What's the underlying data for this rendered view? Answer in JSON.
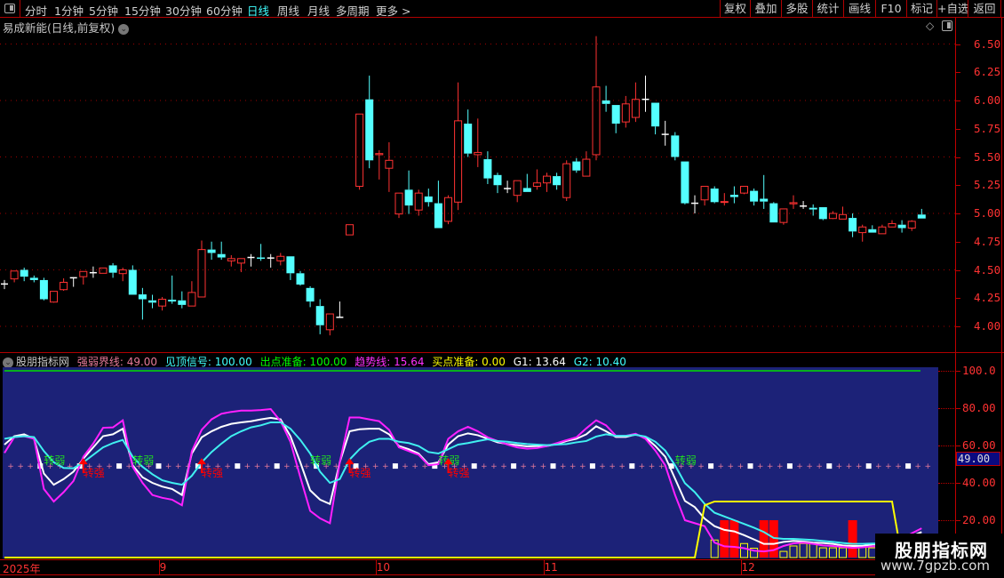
{
  "toolbar": {
    "periods": [
      "分时",
      "1分钟",
      "5分钟",
      "15分钟",
      "30分钟",
      "60分钟",
      "日线",
      "周线",
      "月线",
      "多周期",
      "更多 >"
    ],
    "active_period": "日线",
    "buttons": [
      "复权",
      "叠加",
      "多股",
      "统计",
      "画线",
      "F10",
      "标记",
      "+自选",
      "返回"
    ]
  },
  "chart_title": "易成新能(日线,前复权)",
  "indicator_header": {
    "name": "股朋指标网",
    "items": [
      {
        "label": "强弱界线: 49.00",
        "color": "#e67a9a"
      },
      {
        "label": "见顶信号: 100.00",
        "color": "#40ffff"
      },
      {
        "label": "出点准备: 100.00",
        "color": "#00ff00"
      },
      {
        "label": "趋势线: 15.64",
        "color": "#ff30ff"
      },
      {
        "label": "买点准备: 0.00",
        "color": "#ffff00"
      },
      {
        "label": "G1: 13.64",
        "color": "#ffffff"
      },
      {
        "label": "G2: 10.40",
        "color": "#40ffff"
      }
    ]
  },
  "indicator_value_box": "49.00",
  "watermark": {
    "title": "股朋指标网",
    "url": "www.7gpzb.com"
  },
  "colors": {
    "up": "#ff3232",
    "down": "#54ffff",
    "panel_bg": "#1c2278",
    "axis": "#ff3232"
  },
  "chart_data": [
    {
      "type": "candlestick",
      "title": "易成新能(日线,前复权)",
      "ylim": [
        3.9,
        6.6
      ],
      "y_ticks": [
        "6.50",
        "6.25",
        "6.00",
        "5.75",
        "5.50",
        "5.25",
        "5.00",
        "4.75",
        "4.50",
        "4.25",
        "4.00"
      ],
      "grid_values": [
        6.5,
        6.0,
        5.5,
        5.0,
        4.5,
        4.0
      ],
      "x_labels": [
        {
          "label": "2025年",
          "index": 0
        },
        {
          "label": "9",
          "index": 16
        },
        {
          "label": "10",
          "index": 38
        },
        {
          "label": "11",
          "index": 55
        },
        {
          "label": "12",
          "index": 75
        }
      ],
      "ohlc": [
        [
          4.375,
          4.41,
          4.33,
          4.375
        ],
        [
          4.42,
          4.49,
          4.39,
          4.49
        ],
        [
          4.5,
          4.52,
          4.4,
          4.44
        ],
        [
          4.43,
          4.45,
          4.39,
          4.41
        ],
        [
          4.41,
          4.43,
          4.23,
          4.24
        ],
        [
          4.215,
          4.31,
          4.21,
          4.31
        ],
        [
          4.325,
          4.425,
          4.315,
          4.39
        ],
        [
          4.43,
          4.435,
          4.35,
          4.43
        ],
        [
          4.44,
          4.486,
          4.37,
          4.486
        ],
        [
          4.475,
          4.53,
          4.43,
          4.475
        ],
        [
          4.47,
          4.517,
          4.47,
          4.517
        ],
        [
          4.54,
          4.56,
          4.43,
          4.475
        ],
        [
          4.467,
          4.52,
          4.4,
          4.5
        ],
        [
          4.5,
          4.54,
          4.28,
          4.28
        ],
        [
          4.283,
          4.34,
          4.06,
          4.24
        ],
        [
          4.23,
          4.28,
          4.16,
          4.21
        ],
        [
          4.18,
          4.26,
          4.14,
          4.24
        ],
        [
          4.236,
          4.45,
          4.2,
          4.22
        ],
        [
          4.23,
          4.31,
          4.16,
          4.19
        ],
        [
          4.18,
          4.4,
          4.18,
          4.3
        ],
        [
          4.26,
          4.76,
          4.26,
          4.68
        ],
        [
          4.68,
          4.75,
          4.59,
          4.65
        ],
        [
          4.64,
          4.75,
          4.59,
          4.61
        ],
        [
          4.58,
          4.63,
          4.53,
          4.6
        ],
        [
          4.56,
          4.6,
          4.48,
          4.6
        ],
        [
          4.61,
          4.64,
          4.53,
          4.61
        ],
        [
          4.61,
          4.73,
          4.58,
          4.6
        ],
        [
          4.605,
          4.64,
          4.52,
          4.605
        ],
        [
          4.58,
          4.65,
          4.54,
          4.62
        ],
        [
          4.62,
          4.62,
          4.41,
          4.47
        ],
        [
          4.47,
          4.49,
          4.36,
          4.37
        ],
        [
          4.34,
          4.355,
          4.17,
          4.22
        ],
        [
          4.18,
          4.24,
          3.93,
          4.01
        ],
        [
          3.97,
          4.11,
          3.92,
          4.11
        ],
        [
          4.08,
          4.22,
          4.075,
          4.08
        ],
        [
          4.81,
          4.9,
          4.81,
          4.9
        ],
        [
          5.24,
          5.88,
          5.21,
          5.88
        ],
        [
          6.01,
          6.22,
          5.4,
          5.47
        ],
        [
          5.52,
          5.56,
          5.3,
          5.53
        ],
        [
          5.4,
          5.63,
          5.19,
          5.47
        ],
        [
          4.995,
          5.18,
          4.96,
          5.18
        ],
        [
          5.21,
          5.38,
          4.995,
          5.07
        ],
        [
          5.03,
          5.21,
          4.98,
          5.18
        ],
        [
          5.15,
          5.22,
          5.06,
          5.1
        ],
        [
          5.09,
          5.29,
          4.87,
          4.87
        ],
        [
          4.93,
          5.16,
          4.905,
          5.14
        ],
        [
          5.1,
          6.16,
          5.03,
          5.82
        ],
        [
          5.795,
          5.92,
          5.5,
          5.53
        ],
        [
          5.52,
          5.84,
          5.41,
          5.54
        ],
        [
          5.48,
          5.55,
          5.26,
          5.31
        ],
        [
          5.34,
          5.36,
          5.18,
          5.25
        ],
        [
          5.22,
          5.29,
          5.18,
          5.22
        ],
        [
          5.16,
          5.29,
          5.1,
          5.29
        ],
        [
          5.225,
          5.35,
          5.19,
          5.19
        ],
        [
          5.24,
          5.39,
          5.21,
          5.27
        ],
        [
          5.27,
          5.36,
          5.19,
          5.33
        ],
        [
          5.33,
          5.36,
          5.21,
          5.25
        ],
        [
          5.14,
          5.47,
          5.11,
          5.44
        ],
        [
          5.46,
          5.49,
          5.36,
          5.38
        ],
        [
          5.33,
          5.55,
          5.33,
          5.48
        ],
        [
          5.52,
          6.57,
          5.47,
          6.12
        ],
        [
          6.0,
          6.13,
          5.9,
          5.97
        ],
        [
          5.96,
          5.96,
          5.71,
          5.795
        ],
        [
          5.81,
          6.04,
          5.76,
          5.97
        ],
        [
          5.85,
          6.16,
          5.81,
          6.01
        ],
        [
          6.01,
          6.22,
          5.9,
          6.01
        ],
        [
          5.98,
          5.98,
          5.7,
          5.77
        ],
        [
          5.7,
          5.82,
          5.6,
          5.7
        ],
        [
          5.69,
          5.72,
          5.47,
          5.5
        ],
        [
          5.46,
          5.46,
          5.08,
          5.09
        ],
        [
          5.09,
          5.16,
          5.0,
          5.09
        ],
        [
          5.12,
          5.24,
          5.07,
          5.24
        ],
        [
          5.22,
          5.24,
          5.09,
          5.1
        ],
        [
          5.1,
          5.18,
          5.07,
          5.105
        ],
        [
          5.165,
          5.24,
          5.09,
          5.145
        ],
        [
          5.18,
          5.24,
          5.17,
          5.24
        ],
        [
          5.2,
          5.22,
          5.07,
          5.105
        ],
        [
          5.13,
          5.34,
          5.04,
          5.105
        ],
        [
          5.09,
          5.1,
          4.92,
          4.92
        ],
        [
          4.92,
          5.04,
          4.9,
          5.04
        ],
        [
          5.085,
          5.16,
          5.04,
          5.095
        ],
        [
          5.065,
          5.11,
          5.04,
          5.065
        ],
        [
          5.05,
          5.08,
          4.98,
          5.035
        ],
        [
          5.055,
          5.055,
          4.94,
          4.95
        ],
        [
          4.955,
          5.02,
          4.95,
          5.0
        ],
        [
          4.95,
          5.06,
          4.95,
          4.99
        ],
        [
          4.96,
          5.0,
          4.79,
          4.84
        ],
        [
          4.83,
          4.9,
          4.75,
          4.88
        ],
        [
          4.86,
          4.895,
          4.83,
          4.83
        ],
        [
          4.82,
          4.9,
          4.82,
          4.88
        ],
        [
          4.88,
          4.94,
          4.88,
          4.91
        ],
        [
          4.9,
          4.94,
          4.83,
          4.87
        ],
        [
          4.87,
          4.94,
          4.845,
          4.93
        ],
        [
          4.99,
          5.04,
          4.955,
          4.955
        ]
      ]
    },
    {
      "type": "line",
      "title": "股朋指标网",
      "ylim": [
        0,
        102
      ],
      "y_ticks": [
        "100.0",
        "80.00",
        "60.00",
        "40.00",
        "20.00"
      ],
      "threshold": 49,
      "top_line": 100,
      "series": [
        {
          "name": "G1",
          "color": "#ffffff",
          "values": [
            60.5,
            65,
            66,
            63.6,
            45,
            39,
            42,
            46,
            53,
            59,
            65,
            66,
            69,
            49.4,
            43,
            40,
            38,
            36.7,
            33.5,
            55.7,
            64.4,
            67.6,
            70,
            71.6,
            72.4,
            73,
            74,
            74.8,
            74,
            65,
            51,
            36,
            31,
            28.7,
            51,
            67.6,
            68.7,
            69,
            69,
            66,
            59.7,
            58,
            55.7,
            50,
            51,
            60.5,
            65,
            66.5,
            65.5,
            63.6,
            61.7,
            60.8,
            60.2,
            59.5,
            59.7,
            59.7,
            60.8,
            62.4,
            63.6,
            66,
            70.3,
            67.6,
            64.6,
            64.6,
            65.9,
            64.4,
            59.7,
            54,
            42.2,
            30.3,
            27,
            20.8,
            16.8,
            14.8,
            14,
            12,
            9.7,
            7.3,
            7.3,
            8.4,
            8.9,
            8.6,
            8,
            7.8,
            7.3,
            6.5,
            6.2,
            6.2,
            7,
            7,
            7,
            9,
            11.5,
            13.64
          ]
        },
        {
          "name": "趋势线",
          "color": "#ff20ff",
          "values": [
            56,
            64.5,
            65,
            63.6,
            36.7,
            30,
            35,
            41,
            54,
            61,
            69.5,
            69.7,
            73.5,
            48.6,
            40,
            33.5,
            32,
            31,
            28,
            57,
            68.4,
            74,
            77,
            78,
            78.7,
            78.7,
            79,
            79.5,
            73,
            62,
            43,
            25,
            21,
            18.4,
            51,
            75,
            75,
            74,
            73,
            68.4,
            59,
            57,
            55,
            49.4,
            50,
            63.6,
            67.6,
            70,
            67.6,
            64.4,
            62.4,
            60.5,
            59,
            58.3,
            58.6,
            59.7,
            61.3,
            62.9,
            64.4,
            69.2,
            73.5,
            70.8,
            65.2,
            65.2,
            66.3,
            63.6,
            57.3,
            49.4,
            33.5,
            20,
            18.4,
            16.8,
            8,
            6,
            5.7,
            5,
            3.7,
            3.3,
            4,
            6.2,
            7.6,
            8,
            7.3,
            6.5,
            6.2,
            5.7,
            5.2,
            5.5,
            6,
            6,
            6,
            10,
            13,
            15.64
          ]
        },
        {
          "name": "G2",
          "color": "#40f0f0",
          "values": [
            63.6,
            64.5,
            65,
            64.5,
            57,
            51,
            48,
            47.8,
            51,
            55,
            59,
            61.3,
            63,
            54,
            48.6,
            44.6,
            41.4,
            40,
            39,
            43.8,
            51,
            56.5,
            61,
            65,
            67.6,
            69.7,
            70.8,
            72.4,
            72.4,
            69,
            63,
            55.7,
            46,
            40,
            42,
            52.5,
            58,
            62,
            63.6,
            63.6,
            62,
            61.3,
            59.7,
            56.5,
            55.7,
            58,
            60.5,
            61.3,
            62.4,
            63.3,
            62.4,
            62,
            61.3,
            60.8,
            60.5,
            60.2,
            60.5,
            60.8,
            61.7,
            62.4,
            64.8,
            66,
            65.2,
            65.2,
            65.7,
            64.8,
            62,
            57.3,
            49.4,
            39.8,
            35,
            28.7,
            24,
            22,
            20,
            18,
            16,
            13.7,
            10.5,
            10,
            10,
            9.7,
            9.4,
            8.9,
            8.4,
            7.8,
            7.3,
            7.3,
            7.5,
            7.5,
            7.5,
            8,
            9,
            10.4
          ]
        },
        {
          "name": "买点准备",
          "color": "#ffff00",
          "values": [
            0,
            0,
            0,
            0,
            0,
            0,
            0,
            0,
            0,
            0,
            0,
            0,
            0,
            0,
            0,
            0,
            0,
            0,
            0,
            0,
            0,
            0,
            0,
            0,
            0,
            0,
            0,
            0,
            0,
            0,
            0,
            0,
            0,
            0,
            0,
            0,
            0,
            0,
            0,
            0,
            0,
            0,
            0,
            0,
            0,
            0,
            0,
            0,
            0,
            0,
            0,
            0,
            0,
            0,
            0,
            0,
            0,
            0,
            0,
            0,
            0,
            0,
            0,
            0,
            0,
            0,
            0,
            0,
            0,
            0,
            0,
            28,
            30,
            30,
            30,
            30,
            30,
            30,
            30,
            30,
            30,
            30,
            30,
            30,
            30,
            30,
            30,
            30,
            30,
            30,
            30,
            0,
            0,
            0
          ]
        }
      ],
      "red_bars": {
        "indices": [
          73,
          74,
          77,
          78,
          86
        ],
        "value": 20
      },
      "yellow_bars": {
        "indices": [
          72,
          75,
          76,
          79,
          80,
          81,
          82,
          83,
          84,
          85,
          87,
          88
        ],
        "values": [
          9.4,
          7.5,
          5,
          3.3,
          6.2,
          7.5,
          7.5,
          5.2,
          5.2,
          5.2,
          6.2,
          5.2
        ]
      },
      "signals": {
        "weak_label": "转弱",
        "weak_indices": [
          4,
          13,
          31,
          44,
          68
        ],
        "strong_label": "转强",
        "strong_indices": [
          8,
          20,
          35,
          45
        ]
      }
    }
  ]
}
